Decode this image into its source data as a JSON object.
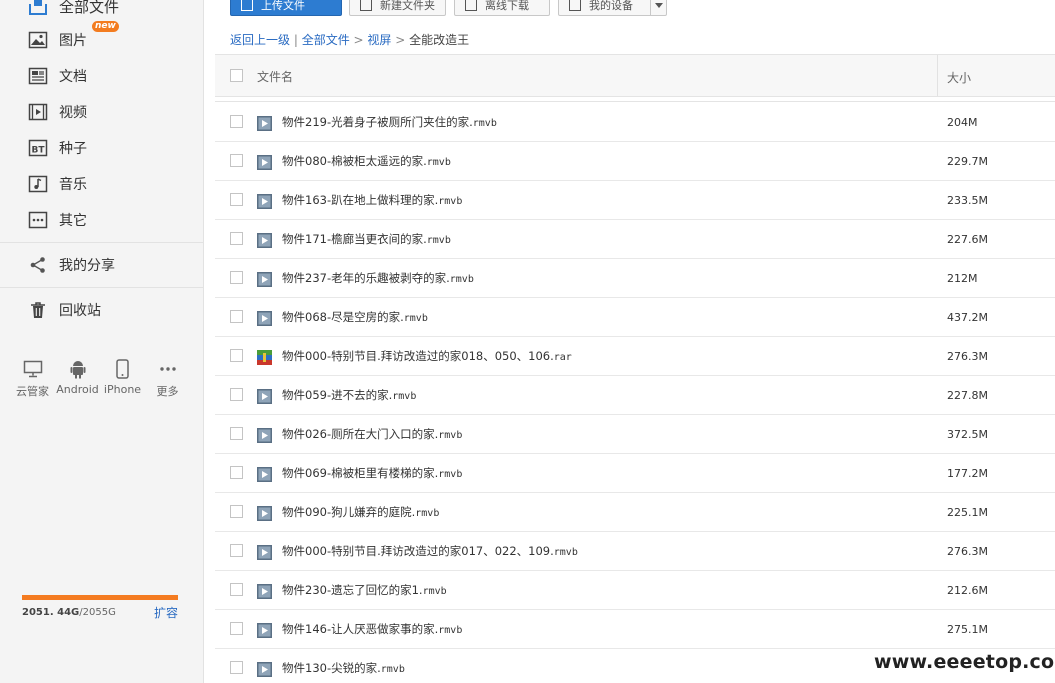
{
  "colors": {
    "accent": "#2d7cd1",
    "quota": "#f47b20",
    "link": "#2a6bc2"
  },
  "sidebar": {
    "all_files": "全部文件",
    "items": [
      {
        "label": "图片",
        "icon": "image-icon",
        "badge": "new"
      },
      {
        "label": "文档",
        "icon": "document-icon"
      },
      {
        "label": "视频",
        "icon": "video-icon"
      },
      {
        "label": "种子",
        "icon": "bt-icon",
        "icon_text": "BT"
      },
      {
        "label": "音乐",
        "icon": "music-icon"
      },
      {
        "label": "其它",
        "icon": "more-dots-icon"
      }
    ],
    "share": "我的分享",
    "recycle": "回收站",
    "devices": [
      {
        "label": "云管家",
        "icon": "monitor-icon"
      },
      {
        "label": "Android",
        "icon": "android-icon"
      },
      {
        "label": "iPhone",
        "icon": "phone-icon"
      },
      {
        "label": "更多",
        "icon": "more-dots-icon"
      }
    ],
    "quota": {
      "used": "2051. 44G",
      "total": "/2055G",
      "fraction": 0.998,
      "expand": "扩容"
    }
  },
  "toolbar": {
    "upload": "上传文件",
    "new_folder": "新建文件夹",
    "offline": "离线下载",
    "my_device": "我的设备"
  },
  "breadcrumb": {
    "back": "返回上一级",
    "sep1": " | ",
    "all": "全部文件",
    "arrow1": " > ",
    "folder": "视屏",
    "arrow2": " > ",
    "current": "全能改造王"
  },
  "table": {
    "col_name": "文件名",
    "col_size": "大小",
    "rows": [
      {
        "name": "物件219-光着身子被厕所门夹住的家.",
        "ext": "rmvb",
        "size": "204M",
        "type": "video"
      },
      {
        "name": "物件080-棉被柜太遥远的家.",
        "ext": "rmvb",
        "size": "229.7M",
        "type": "video"
      },
      {
        "name": "物件163-趴在地上做料理的家.",
        "ext": "rmvb",
        "size": "233.5M",
        "type": "video"
      },
      {
        "name": "物件171-檐廊当更衣间的家.",
        "ext": "rmvb",
        "size": "227.6M",
        "type": "video"
      },
      {
        "name": "物件237-老年的乐趣被剥夺的家.",
        "ext": "rmvb",
        "size": "212M",
        "type": "video"
      },
      {
        "name": "物件068-尽是空房的家.",
        "ext": "rmvb",
        "size": "437.2M",
        "type": "video"
      },
      {
        "name": "物件000-特别节目.拜访改造过的家018、050、106.",
        "ext": "rar",
        "size": "276.3M",
        "type": "archive"
      },
      {
        "name": "物件059-进不去的家.",
        "ext": "rmvb",
        "size": "227.8M",
        "type": "video"
      },
      {
        "name": "物件026-厕所在大门入口的家.",
        "ext": "rmvb",
        "size": "372.5M",
        "type": "video"
      },
      {
        "name": "物件069-棉被柜里有楼梯的家.",
        "ext": "rmvb",
        "size": "177.2M",
        "type": "video"
      },
      {
        "name": "物件090-狗儿嫌弃的庭院.",
        "ext": "rmvb",
        "size": "225.1M",
        "type": "video"
      },
      {
        "name": "物件000-特别节目.拜访改造过的家017、022、109.",
        "ext": "rmvb",
        "size": "276.3M",
        "type": "video"
      },
      {
        "name": "物件230-遗忘了回忆的家1.",
        "ext": "rmvb",
        "size": "212.6M",
        "type": "video"
      },
      {
        "name": "物件146-让人厌恶做家事的家.",
        "ext": "rmvb",
        "size": "275.1M",
        "type": "video"
      },
      {
        "name": "物件130-尖锐的家.",
        "ext": "rmvb",
        "size": "",
        "type": "video"
      }
    ]
  },
  "watermark": "www.eeeetop.com"
}
